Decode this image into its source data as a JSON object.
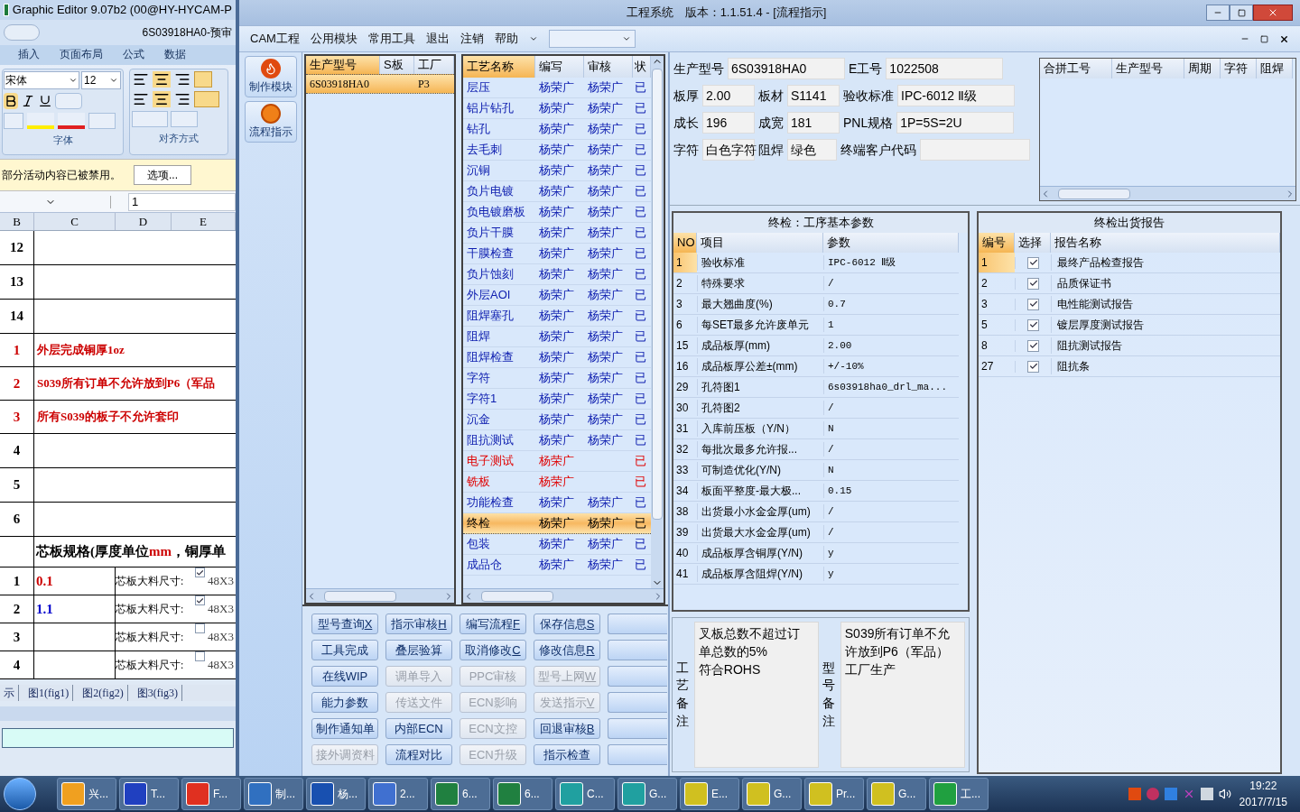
{
  "excel": {
    "title": "Graphic Editor 9.07b2 (00@HY-HYCAM-P",
    "document": "6S03918HA0-预审",
    "ribbon_tabs": [
      "插入",
      "页面布局",
      "公式",
      "数据"
    ],
    "font_name": "宋体",
    "font_size": "12",
    "groups": [
      "字体",
      "对齐方式"
    ],
    "message": "部分活动内容已被禁用。",
    "message_button": "选项...",
    "formula": "1",
    "columns": [
      "B",
      "C",
      "D",
      "E"
    ],
    "rows": [
      {
        "kind": "blank",
        "number": "12"
      },
      {
        "kind": "blank",
        "number": "13"
      },
      {
        "kind": "blank",
        "number": "14"
      },
      {
        "kind": "note",
        "number": "1",
        "text": "外层完成铜厚1oz"
      },
      {
        "kind": "note",
        "number": "2",
        "text": "S039所有订单不允许放到P6（军品"
      },
      {
        "kind": "note",
        "number": "3",
        "text": "所有S039的板子不允许套印"
      },
      {
        "kind": "blank",
        "number": "4"
      },
      {
        "kind": "blank",
        "number": "5"
      },
      {
        "kind": "blank",
        "number": "6"
      },
      {
        "kind": "heading",
        "parts": [
          {
            "text": "芯板规格(厚度单位",
            "highlight": false
          },
          {
            "text": "mm",
            "highlight": true
          },
          {
            "text": "，铜厚单",
            "highlight": false
          }
        ]
      },
      {
        "kind": "core",
        "number": "1",
        "value": "0.1",
        "color": "#cc0000",
        "label": "芯板大料尺寸:",
        "checked": true,
        "size": "48X3"
      },
      {
        "kind": "core",
        "number": "2",
        "value": "1.1",
        "color": "#0000cc",
        "label": "芯板大料尺寸:",
        "checked": true,
        "size": "48X3"
      },
      {
        "kind": "core",
        "number": "3",
        "label": "芯板大料尺寸:",
        "checked": false,
        "size": "48X3"
      },
      {
        "kind": "core",
        "number": "4",
        "label": "芯板大料尺寸:",
        "checked": false,
        "size": "48X3"
      }
    ],
    "sheet_tabs": [
      "示",
      "图1(fig1)",
      "图2(fig2)",
      "图3(fig3)"
    ]
  },
  "app": {
    "title": "工程系统　版本：1.1.51.4 - [流程指示]",
    "menu": [
      "CAM工程",
      "公用模块",
      "常用工具",
      "退出",
      "注销",
      "帮助"
    ],
    "sidebar": [
      {
        "label": "制作模块",
        "kind": "flame"
      },
      {
        "label": "流程指示",
        "kind": "ball"
      }
    ],
    "models": {
      "columns": [
        "生产型号",
        "S板",
        "工厂"
      ],
      "rows": [
        {
          "model": "6S03918HA0",
          "factory": "P3",
          "selected": true
        }
      ]
    },
    "processes": {
      "columns": [
        "工艺名称",
        "编写",
        "审核",
        "状"
      ],
      "rows": [
        {
          "name": "层压",
          "writer": "杨荣广",
          "reviewer": "杨荣广",
          "status": "已",
          "warning": false,
          "selected": false
        },
        {
          "name": "铝片钻孔",
          "writer": "杨荣广",
          "reviewer": "杨荣广",
          "status": "已",
          "warning": false,
          "selected": false
        },
        {
          "name": "钻孔",
          "writer": "杨荣广",
          "reviewer": "杨荣广",
          "status": "已",
          "warning": false,
          "selected": false
        },
        {
          "name": "去毛刺",
          "writer": "杨荣广",
          "reviewer": "杨荣广",
          "status": "已",
          "warning": false,
          "selected": false
        },
        {
          "name": "沉铜",
          "writer": "杨荣广",
          "reviewer": "杨荣广",
          "status": "已",
          "warning": false,
          "selected": false
        },
        {
          "name": "负片电镀",
          "writer": "杨荣广",
          "reviewer": "杨荣广",
          "status": "已",
          "warning": false,
          "selected": false
        },
        {
          "name": "负电镀磨板",
          "writer": "杨荣广",
          "reviewer": "杨荣广",
          "status": "已",
          "warning": false,
          "selected": false
        },
        {
          "name": "负片干膜",
          "writer": "杨荣广",
          "reviewer": "杨荣广",
          "status": "已",
          "warning": false,
          "selected": false
        },
        {
          "name": "干膜检查",
          "writer": "杨荣广",
          "reviewer": "杨荣广",
          "status": "已",
          "warning": false,
          "selected": false
        },
        {
          "name": "负片蚀刻",
          "writer": "杨荣广",
          "reviewer": "杨荣广",
          "status": "已",
          "warning": false,
          "selected": false
        },
        {
          "name": "外层AOI",
          "writer": "杨荣广",
          "reviewer": "杨荣广",
          "status": "已",
          "warning": false,
          "selected": false
        },
        {
          "name": "阻焊塞孔",
          "writer": "杨荣广",
          "reviewer": "杨荣广",
          "status": "已",
          "warning": false,
          "selected": false
        },
        {
          "name": "阻焊",
          "writer": "杨荣广",
          "reviewer": "杨荣广",
          "status": "已",
          "warning": false,
          "selected": false
        },
        {
          "name": "阻焊检查",
          "writer": "杨荣广",
          "reviewer": "杨荣广",
          "status": "已",
          "warning": false,
          "selected": false
        },
        {
          "name": "字符",
          "writer": "杨荣广",
          "reviewer": "杨荣广",
          "status": "已",
          "warning": false,
          "selected": false
        },
        {
          "name": "字符1",
          "writer": "杨荣广",
          "reviewer": "杨荣广",
          "status": "已",
          "warning": false,
          "selected": false
        },
        {
          "name": "沉金",
          "writer": "杨荣广",
          "reviewer": "杨荣广",
          "status": "已",
          "warning": false,
          "selected": false
        },
        {
          "name": "阻抗测试",
          "writer": "杨荣广",
          "reviewer": "杨荣广",
          "status": "已",
          "warning": false,
          "selected": false
        },
        {
          "name": "电子测试",
          "writer": "杨荣广",
          "status": "已",
          "warning": true,
          "selected": false
        },
        {
          "name": "铣板",
          "writer": "杨荣广",
          "status": "已",
          "warning": true,
          "selected": false
        },
        {
          "name": "功能检查",
          "writer": "杨荣广",
          "reviewer": "杨荣广",
          "status": "已",
          "warning": false,
          "selected": false
        },
        {
          "name": "终检",
          "writer": "杨荣广",
          "reviewer": "杨荣广",
          "status": "已",
          "warning": false,
          "selected": true
        },
        {
          "name": "包装",
          "writer": "杨荣广",
          "reviewer": "杨荣广",
          "status": "已",
          "warning": false,
          "selected": false
        },
        {
          "name": "成品仓",
          "writer": "杨荣广",
          "reviewer": "杨荣广",
          "status": "已",
          "warning": false,
          "selected": false
        }
      ]
    },
    "buttons": [
      [
        {
          "label": "型号查询",
          "key": "X",
          "disabled": false
        },
        {
          "label": "指示审核",
          "key": "H",
          "disabled": false
        },
        {
          "label": "编写流程",
          "key": "F",
          "disabled": false
        },
        {
          "label": "保存信息",
          "key": "S",
          "disabled": false
        }
      ],
      [
        {
          "label": "工具完成",
          "disabled": false
        },
        {
          "label": "叠层验算",
          "disabled": false
        },
        {
          "label": "取消修改",
          "key": "C",
          "disabled": false
        },
        {
          "label": "修改信息",
          "key": "R",
          "disabled": false
        }
      ],
      [
        {
          "label": "在线WIP",
          "disabled": false
        },
        {
          "label": "调单导入",
          "disabled": true
        },
        {
          "label": "PPC审核",
          "disabled": true
        },
        {
          "label": "型号上网",
          "key": "W",
          "disabled": true
        }
      ],
      [
        {
          "label": "能力参数",
          "disabled": false
        },
        {
          "label": "传送文件",
          "disabled": true
        },
        {
          "label": "ECN影响",
          "disabled": true
        },
        {
          "label": "发送指示",
          "key": "V",
          "disabled": true
        }
      ],
      [
        {
          "label": "制作通知单",
          "disabled": false
        },
        {
          "label": "内部ECN",
          "disabled": false
        },
        {
          "label": "ECN文控",
          "disabled": true
        },
        {
          "label": "回退审核",
          "key": "B",
          "disabled": false
        }
      ],
      [
        {
          "label": "接外调资料",
          "disabled": true
        },
        {
          "label": "流程对比",
          "disabled": false
        },
        {
          "label": "ECN升级",
          "disabled": true
        },
        {
          "label": "指示检查",
          "disabled": false
        }
      ]
    ],
    "form": [
      [
        {
          "label": "生产型号",
          "value": "6S03918HA0"
        },
        {
          "label": "E工号",
          "value": "1022508"
        }
      ],
      [
        {
          "label": "板厚",
          "value": "2.00"
        },
        {
          "label": "板材",
          "value": "S1141"
        },
        {
          "label": "验收标准",
          "value": "IPC-6012 Ⅱ级"
        }
      ],
      [
        {
          "label": "成长",
          "value": "196"
        },
        {
          "label": "成宽",
          "value": "181"
        },
        {
          "label": "PNL规格",
          "value": "1P=5S=2U"
        }
      ],
      [
        {
          "label": "字符",
          "value": "白色字符"
        },
        {
          "label": "阻焊",
          "value": "绿色"
        },
        {
          "label": "终端客户代码"
        }
      ]
    ],
    "merge_table": {
      "columns": [
        "合拼工号",
        "生产型号",
        "周期",
        "字符",
        "阻焊"
      ]
    },
    "params": {
      "title": "终检：工序基本参数",
      "columns": [
        "NO",
        "项目",
        "参数"
      ],
      "rows": [
        {
          "no": "1",
          "item": "验收标准",
          "value": "IPC-6012 Ⅱ级",
          "selected": true
        },
        {
          "no": "2",
          "item": "特殊要求",
          "value": "/",
          "selected": false
        },
        {
          "no": "3",
          "item": "最大翘曲度(%)",
          "value": "0.7",
          "selected": false
        },
        {
          "no": "6",
          "item": "每SET最多允许废单元",
          "value": "1",
          "selected": false
        },
        {
          "no": "15",
          "item": "成品板厚(mm)",
          "value": "2.00",
          "selected": false
        },
        {
          "no": "16",
          "item": "成品板厚公差±(mm)",
          "value": "+/-10%",
          "selected": false
        },
        {
          "no": "29",
          "item": "孔符图1",
          "value": "6s03918ha0_drl_ma...",
          "selected": false
        },
        {
          "no": "30",
          "item": "孔符图2",
          "value": "/",
          "selected": false
        },
        {
          "no": "31",
          "item": "入库前压板（Y/N）",
          "value": "N",
          "selected": false
        },
        {
          "no": "32",
          "item": "每批次最多允许报...",
          "value": "/",
          "selected": false
        },
        {
          "no": "33",
          "item": "可制造优化(Y/N)",
          "value": "N",
          "selected": false
        },
        {
          "no": "34",
          "item": "板面平整度-最大极...",
          "value": "0.15",
          "selected": false
        },
        {
          "no": "38",
          "item": "出货最小水金金厚(um)",
          "value": "/",
          "selected": false
        },
        {
          "no": "39",
          "item": "出货最大水金金厚(um)",
          "value": "/",
          "selected": false
        },
        {
          "no": "40",
          "item": "成品板厚含铜厚(Y/N)",
          "value": "y",
          "selected": false
        },
        {
          "no": "41",
          "item": "成品板厚含阻焊(Y/N)",
          "value": "y",
          "selected": false
        }
      ]
    },
    "reports": {
      "title": "终检出货报告",
      "columns": [
        "编号",
        "选择",
        "报告名称"
      ],
      "rows": [
        {
          "no": "1",
          "checked": true,
          "name": "最终产品检查报告",
          "selected": true
        },
        {
          "no": "2",
          "checked": true,
          "name": "品质保证书",
          "selected": false
        },
        {
          "no": "3",
          "checked": true,
          "name": "电性能测试报告",
          "selected": false
        },
        {
          "no": "5",
          "checked": true,
          "name": "镀层厚度测试报告",
          "selected": false
        },
        {
          "no": "8",
          "checked": true,
          "name": "阻抗测试报告",
          "selected": false
        },
        {
          "no": "27",
          "checked": true,
          "name": "阻抗条",
          "selected": false
        }
      ]
    },
    "remarks": [
      {
        "label": "工艺备注",
        "lines": [
          "叉板总数不超过订",
          "单总数的5%",
          "符合ROHS"
        ]
      },
      {
        "label": "型号备注",
        "lines": [
          "S039所有订单不允",
          "许放到P6（军品）",
          "工厂生产"
        ]
      }
    ]
  },
  "taskbar": {
    "items": [
      {
        "label": "兴...",
        "color": "#f0a020"
      },
      {
        "label": "T...",
        "color": "#2040c0"
      },
      {
        "label": "F...",
        "color": "#e03020"
      },
      {
        "label": "制...",
        "color": "#3070c0"
      },
      {
        "label": "杨...",
        "color": "#1850b0"
      },
      {
        "label": "2...",
        "color": "#4070d0"
      },
      {
        "label": "6...",
        "color": "#208040"
      },
      {
        "label": "6...",
        "color": "#208040"
      },
      {
        "label": "C...",
        "color": "#20a0a0"
      },
      {
        "label": "G...",
        "color": "#20a0a0"
      },
      {
        "label": "E...",
        "color": "#d0c020"
      },
      {
        "label": "G...",
        "color": "#d0c020"
      },
      {
        "label": "Pr...",
        "color": "#d0c020"
      },
      {
        "label": "G...",
        "color": "#d0c020"
      },
      {
        "label": "工...",
        "color": "#20a040"
      }
    ],
    "time": "19:22",
    "date": "2017/7/15"
  }
}
